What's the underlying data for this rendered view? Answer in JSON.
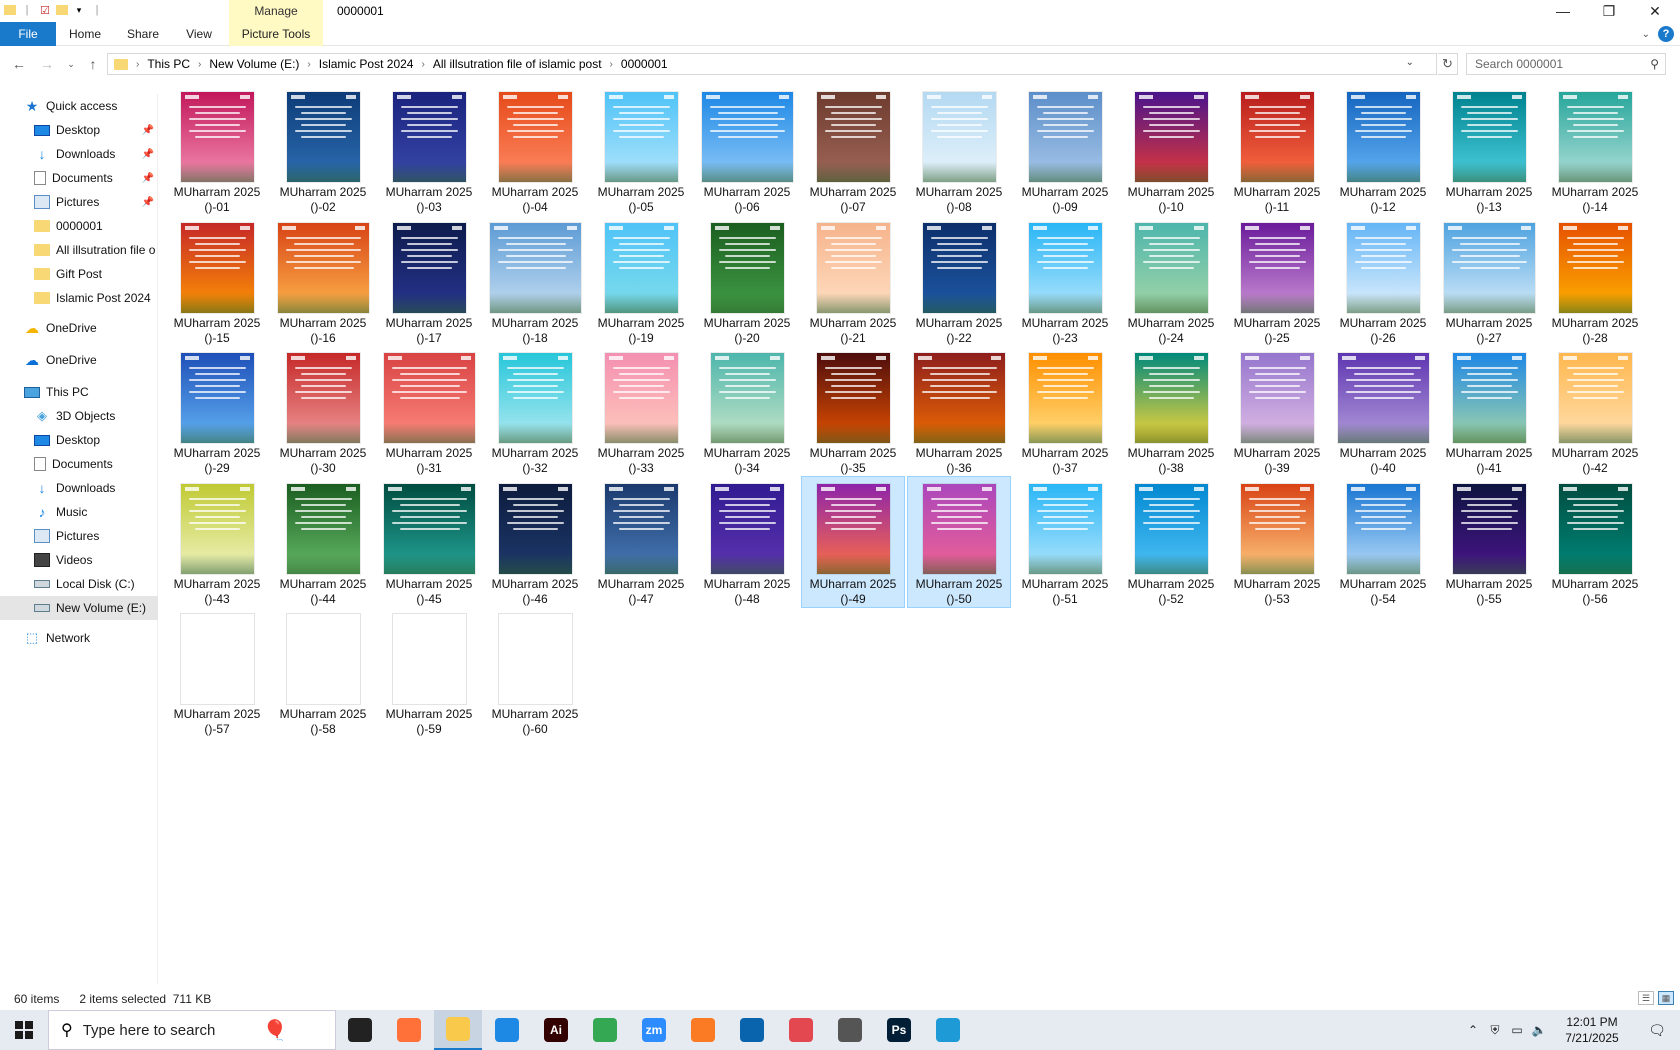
{
  "window": {
    "title": "0000001",
    "manage_tab": "Manage"
  },
  "ribbon": {
    "tabs": [
      {
        "label": "File"
      },
      {
        "label": "Home"
      },
      {
        "label": "Share"
      },
      {
        "label": "View"
      },
      {
        "label": "Picture Tools"
      }
    ]
  },
  "address": {
    "crumbs": [
      "This PC",
      "New Volume (E:)",
      "Islamic Post 2024",
      "All illsutration file of islamic post",
      "0000001"
    ],
    "search_placeholder": "Search 0000001"
  },
  "sidebar": {
    "items": [
      {
        "label": "Quick access",
        "icon": "star-icon",
        "pinned": false
      },
      {
        "label": "Desktop",
        "icon": "desktop-icon",
        "pinned": true
      },
      {
        "label": "Downloads",
        "icon": "download-icon",
        "pinned": true
      },
      {
        "label": "Documents",
        "icon": "documents-icon",
        "pinned": true
      },
      {
        "label": "Pictures",
        "icon": "pictures-icon",
        "pinned": true
      },
      {
        "label": "0000001",
        "icon": "folder-icon",
        "pinned": false
      },
      {
        "label": "All illsutration file o",
        "icon": "folder-icon",
        "pinned": false
      },
      {
        "label": "Gift Post",
        "icon": "folder-icon",
        "pinned": false
      },
      {
        "label": "Islamic Post 2024",
        "icon": "folder-icon",
        "pinned": false
      },
      {
        "label": "OneDrive",
        "icon": "onedrive-personal-icon",
        "pinned": false
      },
      {
        "label": "OneDrive",
        "icon": "onedrive-icon",
        "pinned": false
      },
      {
        "label": "This PC",
        "icon": "this-pc-icon",
        "pinned": false
      },
      {
        "label": "3D Objects",
        "icon": "3d-objects-icon",
        "pinned": false
      },
      {
        "label": "Desktop",
        "icon": "desktop-icon",
        "pinned": false
      },
      {
        "label": "Documents",
        "icon": "documents-icon",
        "pinned": false
      },
      {
        "label": "Downloads",
        "icon": "download-icon",
        "pinned": false
      },
      {
        "label": "Music",
        "icon": "music-icon",
        "pinned": false
      },
      {
        "label": "Pictures",
        "icon": "pictures-icon",
        "pinned": false
      },
      {
        "label": "Videos",
        "icon": "videos-icon",
        "pinned": false
      },
      {
        "label": "Local Disk (C:)",
        "icon": "drive-icon",
        "pinned": false
      },
      {
        "label": "New Volume (E:)",
        "icon": "drive-icon",
        "pinned": false,
        "selected": true
      },
      {
        "label": "Network",
        "icon": "network-icon",
        "pinned": false
      }
    ]
  },
  "files": {
    "name_prefix": "MUharram 2025",
    "items": [
      {
        "suffix": "()-01",
        "colors": [
          "#c2185b",
          "#f48fb1"
        ]
      },
      {
        "suffix": "()-02",
        "colors": [
          "#0d3c78",
          "#2e6fb5"
        ]
      },
      {
        "suffix": "()-03",
        "colors": [
          "#1a237e",
          "#3949ab"
        ]
      },
      {
        "suffix": "()-04",
        "colors": [
          "#e64a19",
          "#ff8a65"
        ]
      },
      {
        "suffix": "()-05",
        "colors": [
          "#4fc3f7",
          "#b3e5fc"
        ]
      },
      {
        "suffix": "()-06",
        "colors": [
          "#1e88e5",
          "#90caf9"
        ],
        "wide": true
      },
      {
        "suffix": "()-07",
        "colors": [
          "#6d3b2e",
          "#a1685a"
        ]
      },
      {
        "suffix": "()-08",
        "colors": [
          "#b3d9f2",
          "#e8f4fb"
        ]
      },
      {
        "suffix": "()-09",
        "colors": [
          "#5c8ec9",
          "#a8c8ea"
        ]
      },
      {
        "suffix": "()-10",
        "colors": [
          "#4a148c",
          "#e53935"
        ]
      },
      {
        "suffix": "()-11",
        "colors": [
          "#b71c1c",
          "#ff7043"
        ]
      },
      {
        "suffix": "()-12",
        "colors": [
          "#1565c0",
          "#64b5f6"
        ]
      },
      {
        "suffix": "()-13",
        "colors": [
          "#00838f",
          "#4dd0e1"
        ]
      },
      {
        "suffix": "()-14",
        "colors": [
          "#26a69a",
          "#b2dfdb"
        ]
      },
      {
        "suffix": "()-15",
        "colors": [
          "#c62828",
          "#ff9800"
        ]
      },
      {
        "suffix": "()-16",
        "colors": [
          "#d84315",
          "#ffb74d"
        ],
        "wide": true
      },
      {
        "suffix": "()-17",
        "colors": [
          "#0d1b4c",
          "#283593"
        ]
      },
      {
        "suffix": "()-18",
        "colors": [
          "#5c9bd5",
          "#c5def2"
        ],
        "wide": true
      },
      {
        "suffix": "()-19",
        "colors": [
          "#4fc3f7",
          "#80deea"
        ]
      },
      {
        "suffix": "()-20",
        "colors": [
          "#1b5e20",
          "#43a047"
        ]
      },
      {
        "suffix": "()-21",
        "colors": [
          "#f6b38b",
          "#ffe0c4"
        ]
      },
      {
        "suffix": "()-22",
        "colors": [
          "#0d2f6b",
          "#1e5aa8"
        ]
      },
      {
        "suffix": "()-23",
        "colors": [
          "#29b6f6",
          "#b3e5fc"
        ]
      },
      {
        "suffix": "()-24",
        "colors": [
          "#4db6ac",
          "#a5d6a7"
        ]
      },
      {
        "suffix": "()-25",
        "colors": [
          "#6a1b9a",
          "#ce93d8"
        ]
      },
      {
        "suffix": "()-26",
        "colors": [
          "#64b5f6",
          "#e3f2fd"
        ]
      },
      {
        "suffix": "()-27",
        "colors": [
          "#4fa3e0",
          "#d6ecfa"
        ],
        "wide": true
      },
      {
        "suffix": "()-28",
        "colors": [
          "#e65100",
          "#ffb300"
        ]
      },
      {
        "suffix": "()-29",
        "colors": [
          "#1e4fb8",
          "#64b5f6"
        ]
      },
      {
        "suffix": "()-30",
        "colors": [
          "#c62828",
          "#ef9a9a"
        ]
      },
      {
        "suffix": "()-31",
        "colors": [
          "#d84343",
          "#ff8a80"
        ],
        "wide": true
      },
      {
        "suffix": "()-32",
        "colors": [
          "#26c6da",
          "#b2ebf2"
        ]
      },
      {
        "suffix": "()-33",
        "colors": [
          "#f48fb1",
          "#ffccbc"
        ]
      },
      {
        "suffix": "()-34",
        "colors": [
          "#4db6ac",
          "#c8e6c9"
        ]
      },
      {
        "suffix": "()-35",
        "colors": [
          "#4e0d0d",
          "#e65100"
        ]
      },
      {
        "suffix": "()-36",
        "colors": [
          "#8e1e1e",
          "#ef6c00"
        ],
        "wide": true
      },
      {
        "suffix": "()-37",
        "colors": [
          "#ff8f00",
          "#ffe082"
        ]
      },
      {
        "suffix": "()-38",
        "colors": [
          "#00897b",
          "#fdd835"
        ]
      },
      {
        "suffix": "()-39",
        "colors": [
          "#9575cd",
          "#e1bee7"
        ]
      },
      {
        "suffix": "()-40",
        "colors": [
          "#5e35b1",
          "#b39ddb"
        ],
        "wide": true
      },
      {
        "suffix": "()-41",
        "colors": [
          "#1e88e5",
          "#a5d6a7"
        ]
      },
      {
        "suffix": "()-42",
        "colors": [
          "#ffb74d",
          "#ffe0b2"
        ]
      },
      {
        "suffix": "()-43",
        "colors": [
          "#c0ca33",
          "#f0f4c3"
        ]
      },
      {
        "suffix": "()-44",
        "colors": [
          "#1b5e20",
          "#66bb6a"
        ]
      },
      {
        "suffix": "()-45",
        "colors": [
          "#004d40",
          "#26a69a"
        ],
        "wide": true
      },
      {
        "suffix": "()-46",
        "colors": [
          "#0d1b3d",
          "#1e3a6e"
        ]
      },
      {
        "suffix": "()-47",
        "colors": [
          "#1a3a6e",
          "#4a7bb8"
        ]
      },
      {
        "suffix": "()-48",
        "colors": [
          "#311b92",
          "#5e35b1"
        ]
      },
      {
        "suffix": "()-49",
        "colors": [
          "#8e24aa",
          "#ff7043"
        ]
      },
      {
        "suffix": "()-50",
        "colors": [
          "#ab47bc",
          "#f06292"
        ]
      },
      {
        "suffix": "()-51",
        "colors": [
          "#29b6f6",
          "#b3e5fc"
        ]
      },
      {
        "suffix": "()-52",
        "colors": [
          "#0288d1",
          "#4fc3f7"
        ]
      },
      {
        "suffix": "()-53",
        "colors": [
          "#d84315",
          "#ffcc80"
        ]
      },
      {
        "suffix": "()-54",
        "colors": [
          "#1976d2",
          "#bbdefb"
        ]
      },
      {
        "suffix": "()-55",
        "colors": [
          "#0d1440",
          "#4a148c"
        ]
      },
      {
        "suffix": "()-56",
        "colors": [
          "#004d40",
          "#00897b"
        ]
      },
      {
        "suffix": "()-57",
        "colors": [],
        "blank": true
      },
      {
        "suffix": "()-58",
        "colors": [],
        "blank": true
      },
      {
        "suffix": "()-59",
        "colors": [],
        "blank": true
      },
      {
        "suffix": "()-60",
        "colors": [],
        "blank": true
      }
    ],
    "selected": [
      "()-49",
      "()-50"
    ]
  },
  "status": {
    "item_count": "60 items",
    "selection": "2 items selected  711 KB"
  },
  "taskbar": {
    "search_placeholder": "Type here to search",
    "apps": [
      {
        "name": "task-view",
        "label": "",
        "color": "#222"
      },
      {
        "name": "firefox",
        "label": "",
        "color": "#ff7139"
      },
      {
        "name": "file-explorer",
        "label": "",
        "color": "#f8c94a",
        "active": true
      },
      {
        "name": "vscode",
        "label": "",
        "color": "#1e88e5"
      },
      {
        "name": "illustrator",
        "label": "Ai",
        "color": "#330000"
      },
      {
        "name": "chrome",
        "label": "",
        "color": "#34a853"
      },
      {
        "name": "zoom",
        "label": "zm",
        "color": "#2d8cff"
      },
      {
        "name": "xampp",
        "label": "",
        "color": "#fb7a24"
      },
      {
        "name": "outlook",
        "label": "",
        "color": "#0a64ad"
      },
      {
        "name": "creative-cloud",
        "label": "",
        "color": "#e34850"
      },
      {
        "name": "pen-tool",
        "label": "",
        "color": "#555"
      },
      {
        "name": "photoshop",
        "label": "Ps",
        "color": "#001e36"
      },
      {
        "name": "app-hex",
        "label": "",
        "color": "#1e9bd7"
      }
    ],
    "time": "12:01 PM",
    "date": "7/21/2025"
  }
}
